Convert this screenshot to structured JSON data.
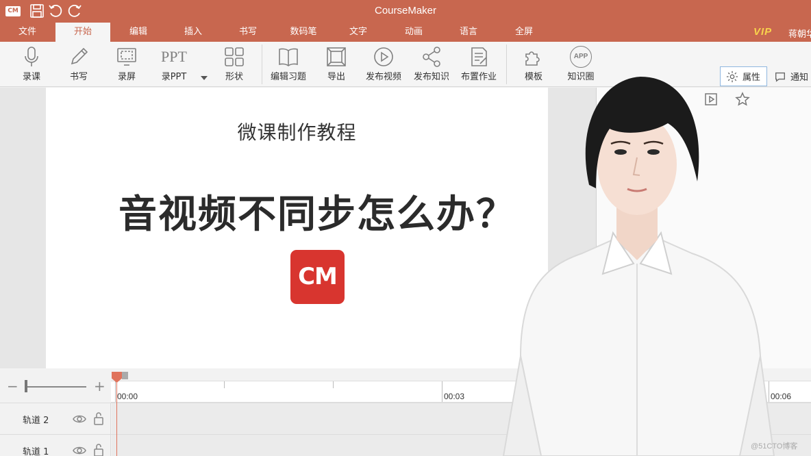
{
  "window": {
    "title": "CourseMaker",
    "app_logo": "CM"
  },
  "quick_access": [
    {
      "icon": "save-icon"
    },
    {
      "icon": "undo-icon"
    },
    {
      "icon": "redo-icon"
    }
  ],
  "menu": {
    "tabs": [
      "文件",
      "开始",
      "编辑",
      "插入",
      "书写",
      "数码笔",
      "文字",
      "动画",
      "语言",
      "全屏"
    ],
    "active": "开始",
    "vip": "VIP",
    "user": "蒋朝华"
  },
  "ribbon": {
    "record_lesson": "录课",
    "write": "书写",
    "record_screen": "录屏",
    "record_ppt": "录PPT",
    "ppt_icon_text": "PPT",
    "shapes": "形状",
    "edit_exercise": "编辑习题",
    "export": "导出",
    "publish_video": "发布视频",
    "publish_knowledge": "发布知识",
    "assign_homework": "布置作业",
    "template": "模板",
    "knowledge_circle": "知识圈",
    "app_icon_text": "APP",
    "properties": "属性",
    "notify": "通知"
  },
  "slide": {
    "subtitle": "微课制作教程",
    "title": "音视频不同步怎么办？",
    "logo_text": "CM",
    "logo_color": "#d8352f"
  },
  "timeline": {
    "zoom_minus": "−",
    "zoom_plus": "+",
    "time_labels": [
      "00:00",
      "00:03",
      "00:06"
    ],
    "tracks": [
      {
        "name": "轨道 2"
      },
      {
        "name": "轨道 1"
      }
    ]
  },
  "colors": {
    "accent": "#c8674f",
    "vip": "#f8d24c",
    "playhead": "#e0735c"
  },
  "watermark": "@51CTO博客"
}
